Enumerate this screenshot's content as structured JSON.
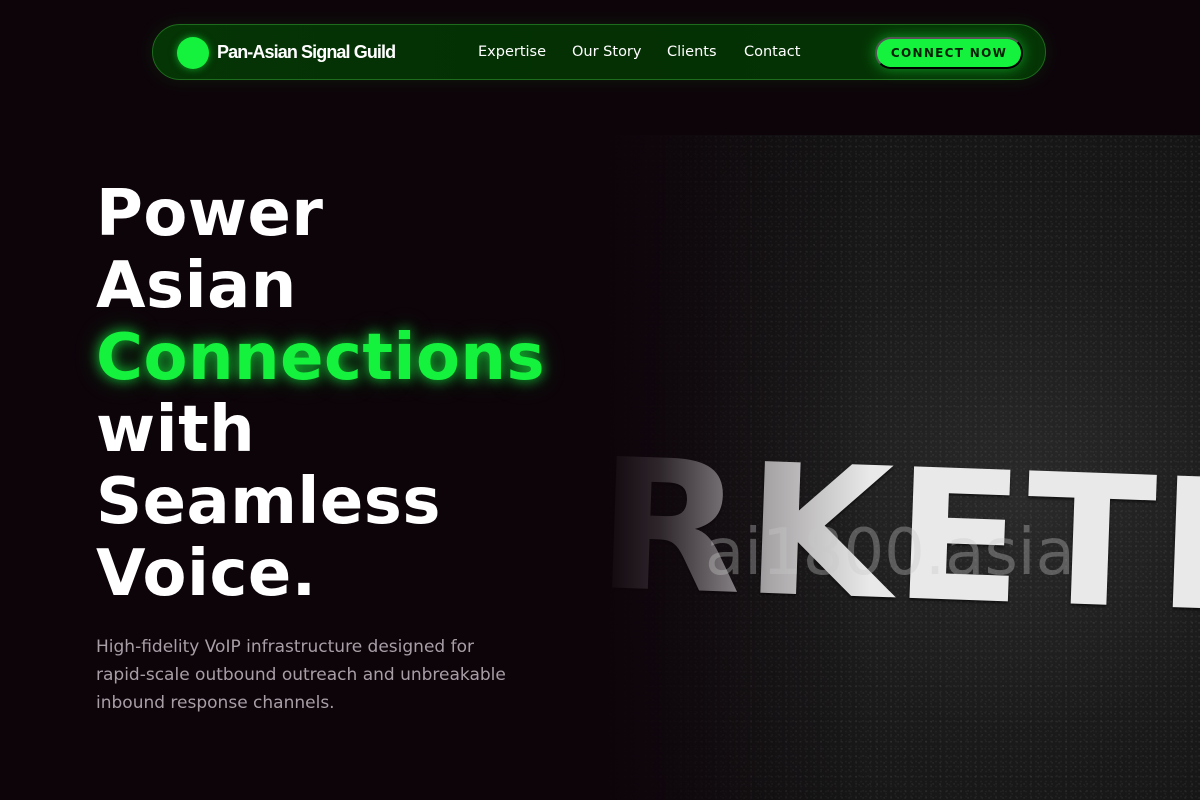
{
  "brand": {
    "name": "Pan-Asian Signal Guild",
    "logo_icon": "green-circle-logo-icon",
    "accent_color": "#14f23d"
  },
  "nav": {
    "links": [
      {
        "label": "Expertise"
      },
      {
        "label": "Our Story"
      },
      {
        "label": "Clients"
      },
      {
        "label": "Contact"
      }
    ],
    "cta_label": "CONNECT NOW"
  },
  "hero": {
    "headline_lines": [
      "Power",
      "Asian",
      "Connections",
      "with",
      "Seamless",
      "Voice."
    ],
    "subtext": "High-fidelity VoIP infrastructure designed for rapid-scale outbound outreach and unbreakable inbound response channels.",
    "image": {
      "sign_text": "RKETI",
      "watermark": "ai1800.asia"
    }
  },
  "colors": {
    "background": "#0d040a",
    "nav_background": "#043004",
    "accent": "#14f23d",
    "subtext": "#a89ea6"
  }
}
